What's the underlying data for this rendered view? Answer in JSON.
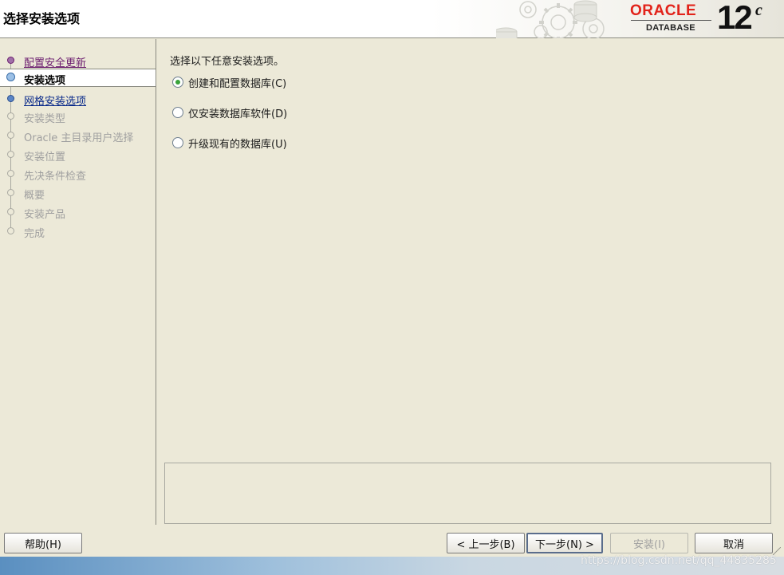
{
  "window_title": "选择安装选项",
  "logo": {
    "brand": "ORACLE",
    "product": "DATABASE",
    "version": "12",
    "version_suffix": "c"
  },
  "steps": [
    {
      "label": "配置安全更新",
      "state": "done"
    },
    {
      "label": "安装选项",
      "state": "current"
    },
    {
      "label": "网格安装选项",
      "state": "link"
    },
    {
      "label": "安装类型",
      "state": "disabled"
    },
    {
      "label": "Oracle 主目录用户选择",
      "state": "disabled"
    },
    {
      "label": "安装位置",
      "state": "disabled"
    },
    {
      "label": "先决条件检查",
      "state": "disabled"
    },
    {
      "label": "概要",
      "state": "disabled"
    },
    {
      "label": "安装产品",
      "state": "disabled"
    },
    {
      "label": "完成",
      "state": "disabled"
    }
  ],
  "main": {
    "prompt": "选择以下任意安装选项。",
    "options": [
      {
        "label": "创建和配置数据库(C)",
        "checked": true
      },
      {
        "label": "仅安装数据库软件(D)",
        "checked": false
      },
      {
        "label": "升级现有的数据库(U)",
        "checked": false
      }
    ]
  },
  "buttons": {
    "help": "帮助(H)",
    "back": "< 上一步(B)",
    "next": "下一步(N) >",
    "install": "安装(I)",
    "cancel": "取消"
  },
  "watermark": "https://blog.csdn.net/qq_44835285"
}
